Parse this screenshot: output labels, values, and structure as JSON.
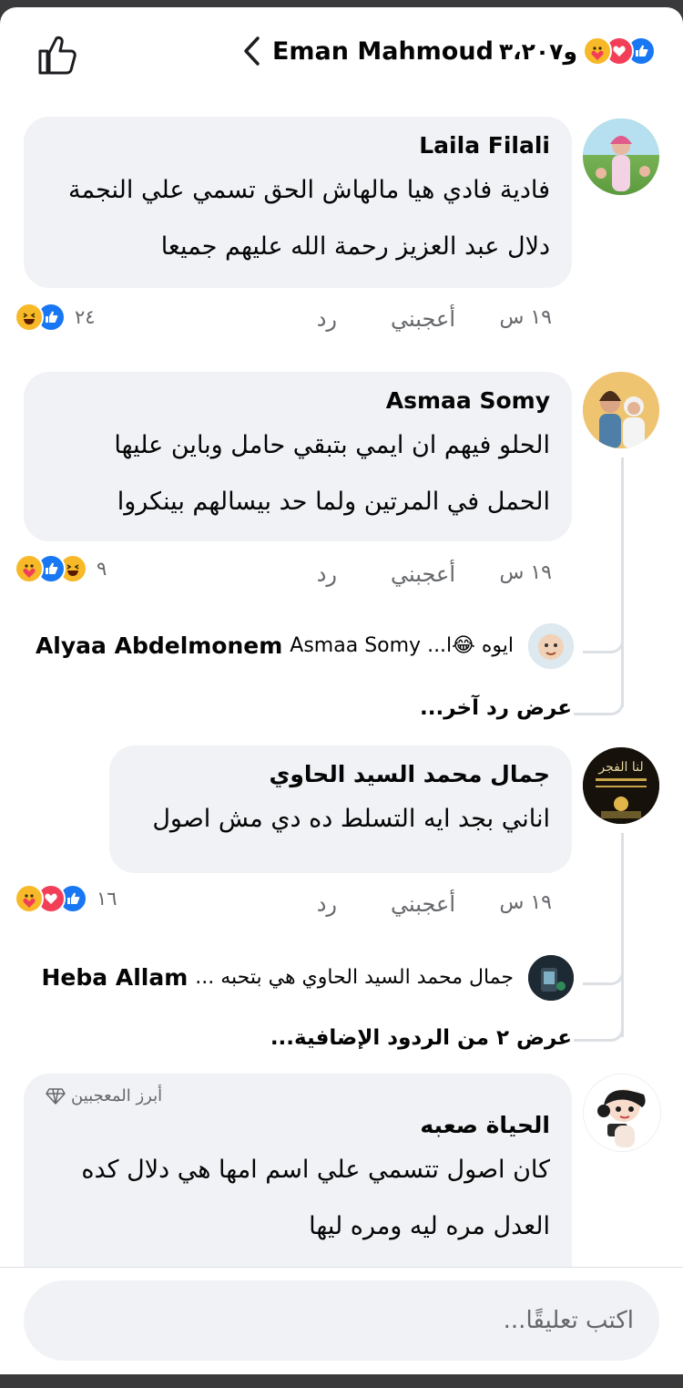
{
  "header": {
    "name": "Eman Mahmoud",
    "count": "و٣،٢٠٧",
    "reactions": [
      "like-icon",
      "love-icon",
      "care-icon"
    ]
  },
  "comments": [
    {
      "author": "Laila Filali",
      "lines": [
        "فادية فادي هيا مالهاش الحق تسمي علي النجمة",
        "دلال عبد العزيز رحمة الله عليهم جميعا"
      ],
      "time": "١٩ س",
      "like": "أعجبني",
      "reply": "رد",
      "react_count": "٢٤",
      "reactions": [
        "like-icon",
        "haha-icon"
      ]
    },
    {
      "author": "Asmaa Somy",
      "lines": [
        "الحلو فيهم ان ايمي بتبقي حامل وباين عليها",
        "الحمل في المرتين ولما حد بيسالهم بينكروا"
      ],
      "time": "١٩ س",
      "like": "أعجبني",
      "reply": "رد",
      "react_count": "٩",
      "reactions": [
        "haha-icon",
        "like-icon",
        "care-icon"
      ],
      "reply_preview": {
        "name": "Alyaa Abdelmonem",
        "text": "ايوه 😂ا... Asmaa Somy"
      },
      "more": "عرض رد آخر..."
    },
    {
      "author": "جمال محمد السيد الحاوي",
      "lines": [
        "اناني بجد ايه التسلط ده دي مش اصول"
      ],
      "time": "١٩ س",
      "like": "أعجبني",
      "reply": "رد",
      "react_count": "١٦",
      "reactions": [
        "like-icon",
        "love-icon",
        "care-icon"
      ],
      "reply_preview": {
        "name": "Heba Allam",
        "text": "جمال محمد السيد الحاوي هي بتحبه ..."
      },
      "more": "عرض ٢ من الردود الإضافية..."
    },
    {
      "badge": "أبرز المعجبين",
      "author": "الحياة صعبه",
      "lines": [
        "كان اصول تتسمي علي اسم امها هي دلال كده",
        "العدل مره ليه ومره ليها"
      ]
    }
  ],
  "composer": {
    "placeholder": "اكتب تعليقًا..."
  }
}
